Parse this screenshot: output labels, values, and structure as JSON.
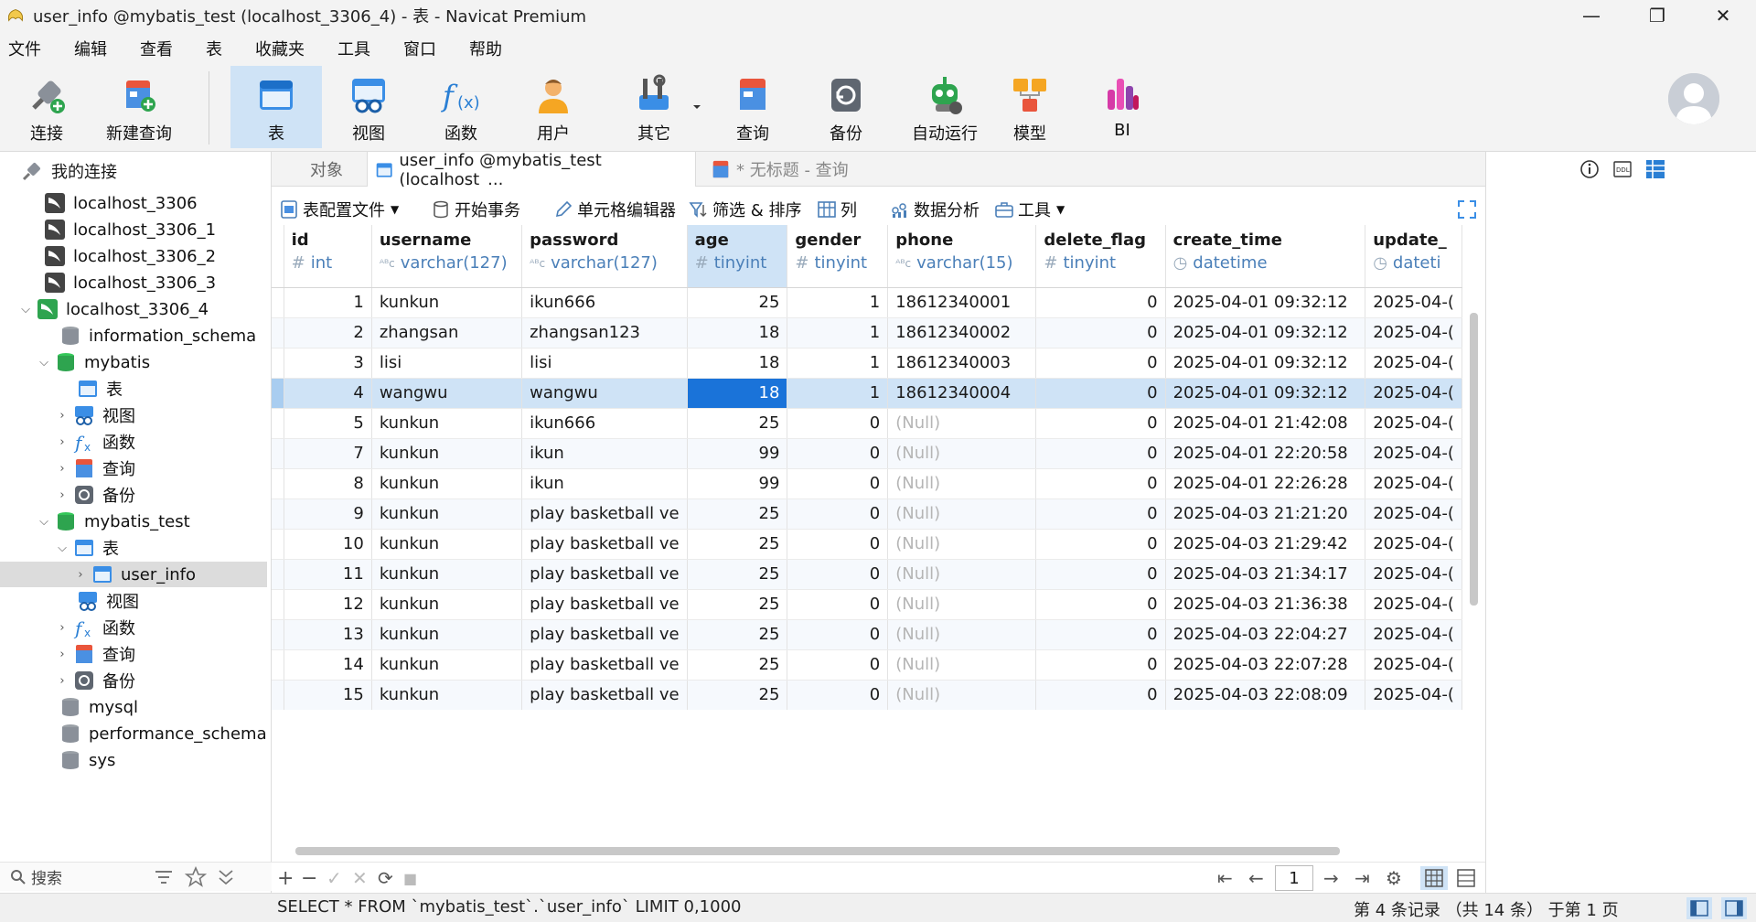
{
  "window": {
    "title": "user_info @mybatis_test (localhost_3306_4) - 表 - Navicat Premium",
    "minimize": "—",
    "maximize": "❐",
    "close": "✕"
  },
  "menu": [
    "文件",
    "编辑",
    "查看",
    "表",
    "收藏夹",
    "工具",
    "窗口",
    "帮助"
  ],
  "ribbon": {
    "connect": "连接",
    "new_query": "新建查询",
    "table": "表",
    "view": "视图",
    "function": "函数",
    "user": "用户",
    "other": "其它",
    "query": "查询",
    "backup": "备份",
    "automation": "自动运行",
    "model": "模型",
    "bi": "BI"
  },
  "sidebar": {
    "header": "我的连接",
    "search_placeholder": "搜索",
    "nodes": [
      {
        "label": "localhost_3306"
      },
      {
        "label": "localhost_3306_1"
      },
      {
        "label": "localhost_3306_2"
      },
      {
        "label": "localhost_3306_3"
      },
      {
        "label": "localhost_3306_4"
      },
      {
        "label": "information_schema"
      },
      {
        "label": "mybatis"
      },
      {
        "label": "表"
      },
      {
        "label": "视图"
      },
      {
        "label": "函数"
      },
      {
        "label": "查询"
      },
      {
        "label": "备份"
      },
      {
        "label": "mybatis_test"
      },
      {
        "label": "表"
      },
      {
        "label": "user_info"
      },
      {
        "label": "视图"
      },
      {
        "label": "函数"
      },
      {
        "label": "查询"
      },
      {
        "label": "备份"
      },
      {
        "label": "mysql"
      },
      {
        "label": "performance_schema"
      },
      {
        "label": "sys"
      }
    ]
  },
  "tabs": {
    "objects": "对象",
    "user_info": "user_info @mybatis_test (localhost_...",
    "untitled": "* 无标题 - 查询"
  },
  "toolbar": {
    "profile": "表配置文件",
    "begin_tx": "开始事务",
    "cell_editor": "单元格编辑器",
    "filter_sort": "筛选 & 排序",
    "columns": "列",
    "analysis": "数据分析",
    "tools": "工具"
  },
  "grid": {
    "columns": [
      {
        "name": "id",
        "type": "int",
        "type_icon": "#"
      },
      {
        "name": "username",
        "type": "varchar(127)",
        "type_icon": "ᴬᴮc"
      },
      {
        "name": "password",
        "type": "varchar(127)",
        "type_icon": "ᴬᴮc"
      },
      {
        "name": "age",
        "type": "tinyint",
        "type_icon": "#"
      },
      {
        "name": "gender",
        "type": "tinyint",
        "type_icon": "#"
      },
      {
        "name": "phone",
        "type": "varchar(15)",
        "type_icon": "ᴬᴮc"
      },
      {
        "name": "delete_flag",
        "type": "tinyint",
        "type_icon": "#"
      },
      {
        "name": "create_time",
        "type": "datetime",
        "type_icon": "◷"
      },
      {
        "name": "update_",
        "type": "dateti",
        "type_icon": "◷"
      }
    ],
    "rows": [
      [
        "1",
        "kunkun",
        "ikun666",
        "25",
        "1",
        "18612340001",
        "0",
        "2025-04-01 09:32:12",
        "2025-04-("
      ],
      [
        "2",
        "zhangsan",
        "zhangsan123",
        "18",
        "1",
        "18612340002",
        "0",
        "2025-04-01 09:32:12",
        "2025-04-("
      ],
      [
        "3",
        "lisi",
        "lisi",
        "18",
        "1",
        "18612340003",
        "0",
        "2025-04-01 09:32:12",
        "2025-04-("
      ],
      [
        "4",
        "wangwu",
        "wangwu",
        "18",
        "1",
        "18612340004",
        "0",
        "2025-04-01 09:32:12",
        "2025-04-("
      ],
      [
        "5",
        "kunkun",
        "ikun666",
        "25",
        "0",
        "(Null)",
        "0",
        "2025-04-01 21:42:08",
        "2025-04-("
      ],
      [
        "7",
        "kunkun",
        "ikun",
        "99",
        "0",
        "(Null)",
        "0",
        "2025-04-01 22:20:58",
        "2025-04-("
      ],
      [
        "8",
        "kunkun",
        "ikun",
        "99",
        "0",
        "(Null)",
        "0",
        "2025-04-01 22:26:28",
        "2025-04-("
      ],
      [
        "9",
        "kunkun",
        "play basketball ve",
        "25",
        "0",
        "(Null)",
        "0",
        "2025-04-03 21:21:20",
        "2025-04-("
      ],
      [
        "10",
        "kunkun",
        "play basketball ve",
        "25",
        "0",
        "(Null)",
        "0",
        "2025-04-03 21:29:42",
        "2025-04-("
      ],
      [
        "11",
        "kunkun",
        "play basketball ve",
        "25",
        "0",
        "(Null)",
        "0",
        "2025-04-03 21:34:17",
        "2025-04-("
      ],
      [
        "12",
        "kunkun",
        "play basketball ve",
        "25",
        "0",
        "(Null)",
        "0",
        "2025-04-03 21:36:38",
        "2025-04-("
      ],
      [
        "13",
        "kunkun",
        "play basketball ve",
        "25",
        "0",
        "(Null)",
        "0",
        "2025-04-03 22:04:27",
        "2025-04-("
      ],
      [
        "14",
        "kunkun",
        "play basketball ve",
        "25",
        "0",
        "(Null)",
        "0",
        "2025-04-03 22:07:28",
        "2025-04-("
      ],
      [
        "15",
        "kunkun",
        "play basketball ve",
        "25",
        "0",
        "(Null)",
        "0",
        "2025-04-03 22:08:09",
        "2025-04-("
      ]
    ]
  },
  "bottom": {
    "add": "+",
    "remove": "−",
    "apply": "✓",
    "discard": "✕",
    "refresh": "⟳",
    "stop": "■",
    "first": "⇤",
    "prev": "←",
    "page": "1",
    "next": "→",
    "last": "⇥",
    "settings": "⚙"
  },
  "status": {
    "sql": "SELECT * FROM `mybatis_test`.`user_info` LIMIT 0,1000",
    "record": "第 4 条记录 （共 14 条） 于第 1 页"
  },
  "colors": {
    "accent": "#1a73d9",
    "selection": "#cfe3f6",
    "highlight_box": "#e53b3b"
  }
}
